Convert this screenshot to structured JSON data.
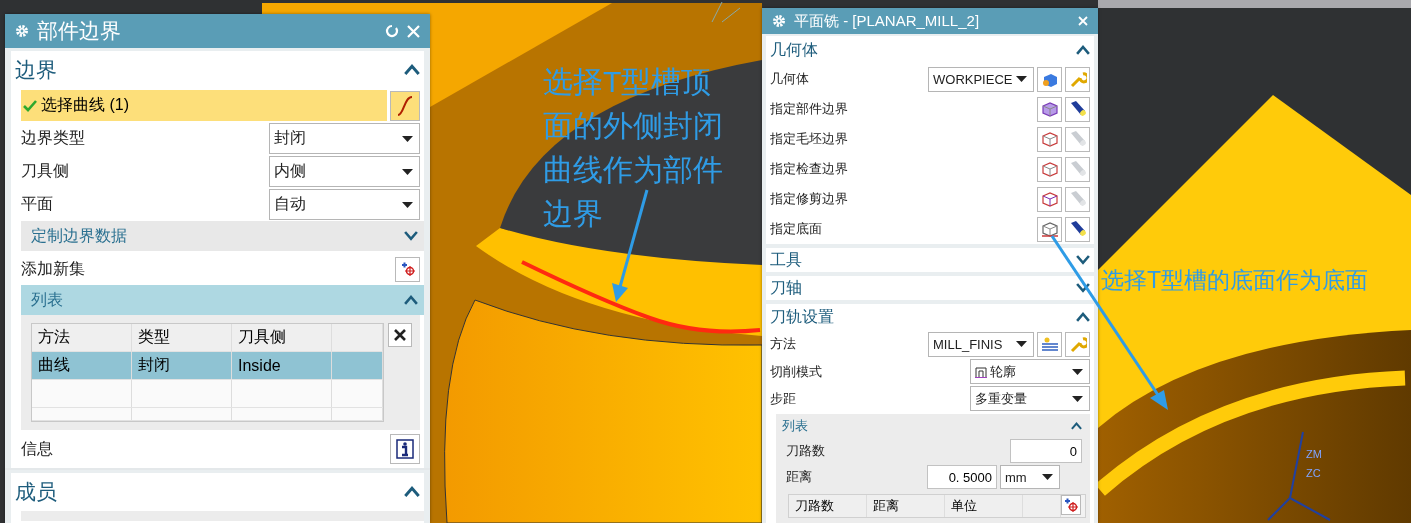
{
  "part_boundary_dialog": {
    "title": "部件边界",
    "boundary": {
      "heading": "边界",
      "expanded": true
    },
    "select_curve": {
      "label": "选择曲线 (1)",
      "checked": true
    },
    "fields": [
      {
        "label": "边界类型",
        "value": "封闭"
      },
      {
        "label": "刀具侧",
        "value": "内侧"
      },
      {
        "label": "平面",
        "value": "自动"
      }
    ],
    "custom_data": {
      "heading": "定制边界数据",
      "expanded": false
    },
    "add_new_set": {
      "label": "添加新集"
    },
    "list": {
      "heading": "列表",
      "expanded": true,
      "columns": [
        "方法",
        "类型",
        "刀具侧"
      ],
      "rows": [
        {
          "cells": [
            "曲线",
            "封闭",
            "Inside"
          ],
          "selected": true
        }
      ]
    },
    "info": {
      "label": "信息"
    },
    "members": {
      "heading": "成员",
      "expanded": true
    }
  },
  "planar_mill_dialog": {
    "title": "平面铣 - [PLANAR_MILL_2]",
    "geometry": {
      "heading": "几何体",
      "expanded": true,
      "field": {
        "label": "几何体",
        "value": "WORKPIECE"
      },
      "specify_rows": [
        {
          "label": "指定部件边界",
          "enabled": true
        },
        {
          "label": "指定毛坯边界",
          "enabled": false
        },
        {
          "label": "指定检查边界",
          "enabled": false
        },
        {
          "label": "指定修剪边界",
          "enabled": false
        },
        {
          "label": "指定底面",
          "enabled": true
        }
      ]
    },
    "tool": {
      "heading": "工具",
      "expanded": false
    },
    "tool_axis": {
      "heading": "刀轴",
      "expanded": false
    },
    "path_settings": {
      "heading": "刀轨设置",
      "expanded": true,
      "method": {
        "label": "方法",
        "value": "MILL_FINIS"
      },
      "cut_pattern": {
        "label": "切削模式",
        "value": "轮廓"
      },
      "stepover": {
        "label": "步距",
        "value": "多重变量"
      },
      "list": {
        "heading": "列表",
        "expanded": true,
        "passes": {
          "label": "刀路数",
          "value": "0"
        },
        "distance": {
          "label": "距离",
          "value": "0. 5000",
          "unit": "mm"
        },
        "columns": [
          "刀路数",
          "距离",
          "单位"
        ]
      }
    }
  },
  "annotations": [
    {
      "text": "选择T型槽顶面的外侧封闭曲线作为部件边界"
    },
    {
      "text": "选择T型槽的底面作为底面"
    }
  ],
  "axis_labels": [
    "ZM",
    "ZC"
  ]
}
